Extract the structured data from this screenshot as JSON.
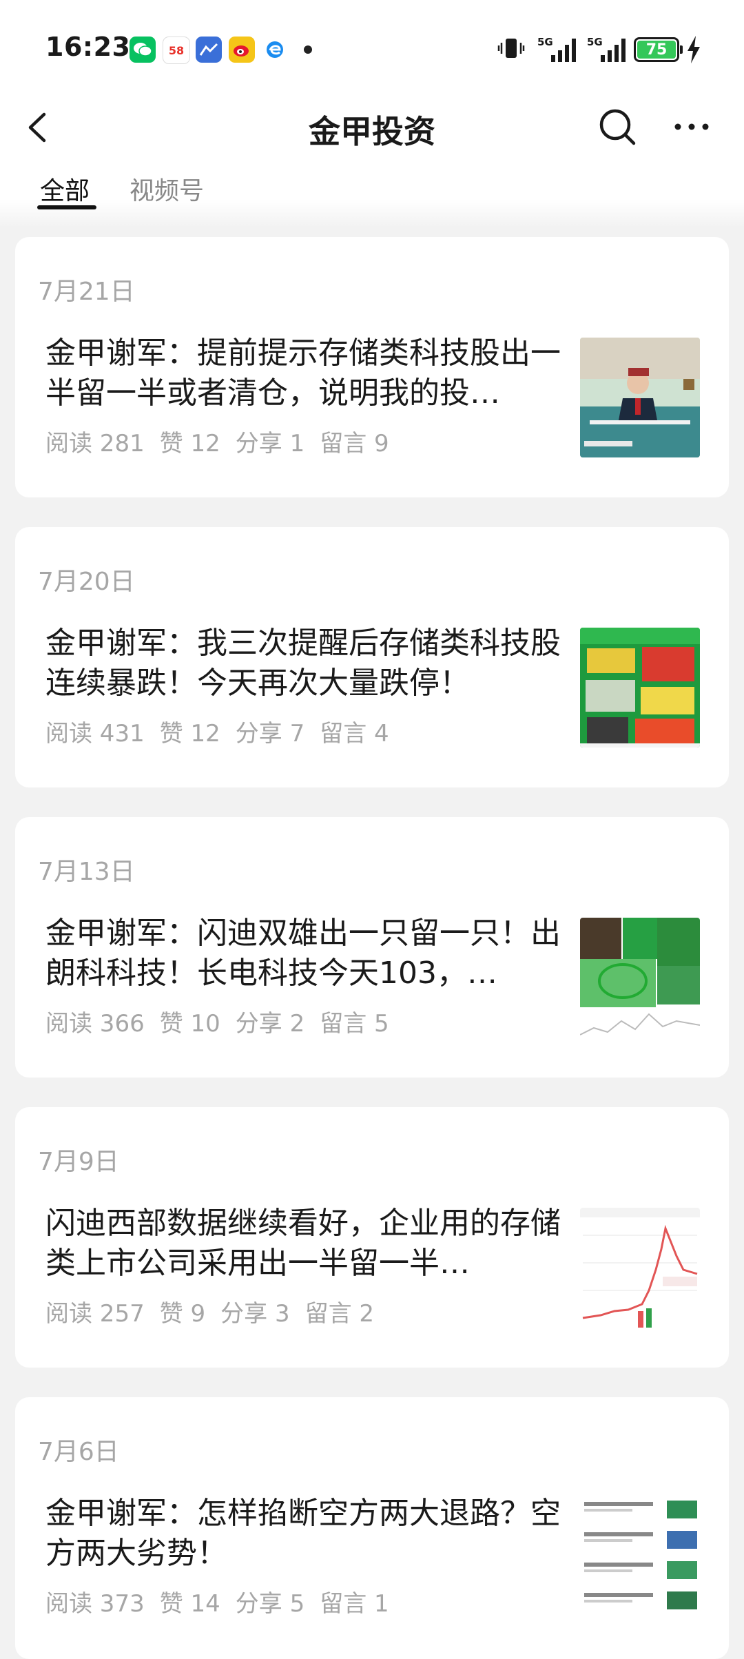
{
  "status_bar": {
    "time": "16:23",
    "battery": "75",
    "network_1": "5G",
    "network_2": "5G",
    "apps": [
      "wechat-icon",
      "58-icon",
      "maps-icon",
      "weibo-icon",
      "browser-icon"
    ],
    "app_58_label": "58"
  },
  "nav": {
    "title": "金甲投资"
  },
  "tabs": {
    "all": "全部",
    "video": "视频号"
  },
  "articles": [
    {
      "date": "7月21日",
      "title": "金甲谢军：提前提示存储类科技股出一半留一半或者清仓，说明我的投…",
      "reads": "阅读 281",
      "likes": "赞 12",
      "shares": "分享 1",
      "comments": "留言 9"
    },
    {
      "date": "7月20日",
      "title": "金甲谢军：我三次提醒后存储类科技股连续暴跌！今天再次大量跌停！",
      "reads": "阅读 431",
      "likes": "赞 12",
      "shares": "分享 7",
      "comments": "留言 4"
    },
    {
      "date": "7月13日",
      "title": "金甲谢军：闪迪双雄出一只留一只！出朗科科技！长电科技今天103，…",
      "reads": "阅读 366",
      "likes": "赞 10",
      "shares": "分享 2",
      "comments": "留言 5"
    },
    {
      "date": "7月9日",
      "title": "闪迪西部数据继续看好，企业用的存储类上市公司采用出一半留一半…",
      "reads": "阅读 257",
      "likes": "赞 9",
      "shares": "分享 3",
      "comments": "留言 2"
    },
    {
      "date": "7月6日",
      "title": "金甲谢军：怎样掐断空方两大退路？空方两大劣势！",
      "reads": "阅读 373",
      "likes": "赞 14",
      "shares": "分享 5",
      "comments": "留言 1"
    }
  ],
  "colors": {
    "background": "#f2f2f2",
    "card": "#ffffff",
    "muted": "#a6a6a6",
    "battery": "#34c759"
  }
}
